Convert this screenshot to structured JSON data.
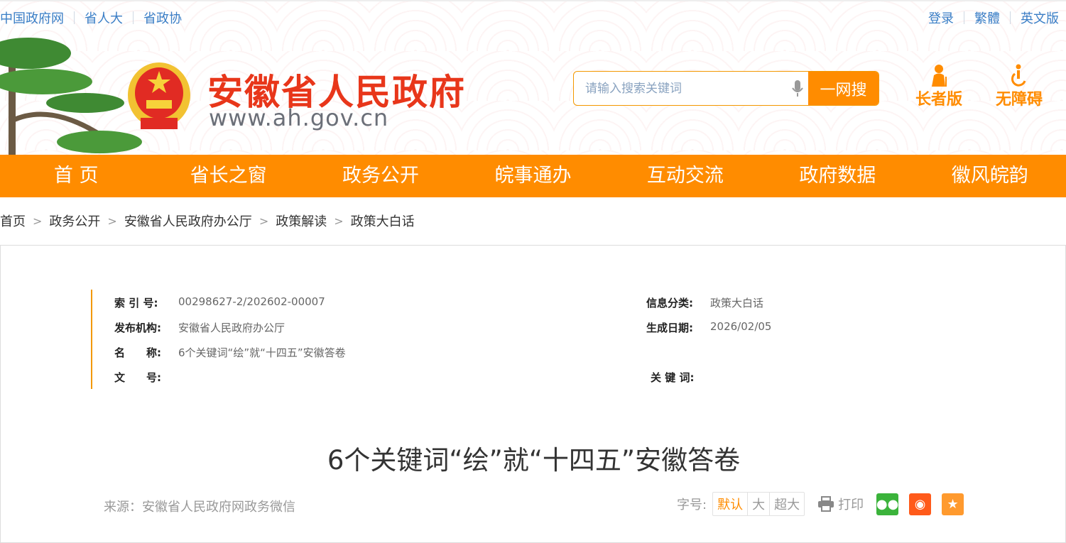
{
  "top_left_links": [
    "中国政府网",
    "省人大",
    "省政协"
  ],
  "top_right_links": [
    "登录",
    "繁體",
    "英文版"
  ],
  "site": {
    "title": "安徽省人民政府",
    "url": "www.ah.gov.cn"
  },
  "search": {
    "placeholder": "请输入搜索关键词",
    "button": "一网搜"
  },
  "modes": [
    "长者版",
    "无障碍"
  ],
  "nav": [
    "首 页",
    "省长之窗",
    "政务公开",
    "皖事通办",
    "互动交流",
    "政府数据",
    "徽风皖韵"
  ],
  "breadcrumb": [
    "首页",
    "政务公开",
    "安徽省人民政府办公厅",
    "政策解读",
    "政策大白话"
  ],
  "meta": {
    "index_label": "索 引 号:",
    "index": "00298627-2/202602-00007",
    "category_label": "信息分类:",
    "category": "政策大白话",
    "publisher_label": "发布机构:",
    "publisher": "安徽省人民政府办公厅",
    "date_label": "生成日期:",
    "date": "2026/02/05",
    "name_label": "名　　称:",
    "name": "6个关键词“绘”就“十四五”安徽答卷",
    "docno_label": "文　　号:",
    "docno": "",
    "keywords_label": "关 键 词:",
    "keywords": ""
  },
  "article": {
    "title": "6个关键词“绘”就“十四五”安徽答卷",
    "source": "来源：安徽省人民政府网政务微信"
  },
  "tools": {
    "font_label": "字号:",
    "sizes": [
      "默认",
      "大",
      "超大"
    ],
    "print": "打印"
  },
  "colors": {
    "accent": "#ff8c00",
    "title_red": "#e8361a",
    "link": "#3a7ec6"
  }
}
